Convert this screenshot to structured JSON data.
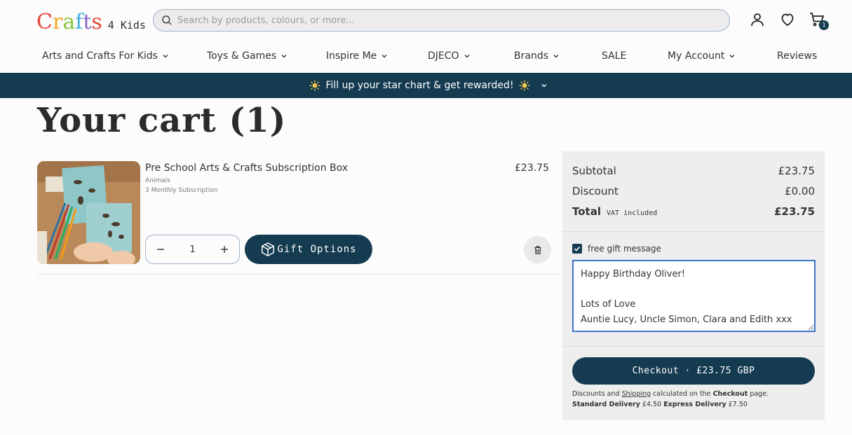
{
  "header": {
    "logo_word": "Crafts",
    "logo_letters": [
      "C",
      "r",
      "a",
      "f",
      "t",
      "s"
    ],
    "logo_colors": [
      "#e8473c",
      "#f4a51c",
      "#8cc63f",
      "#3fb1e0",
      "#8a63c9",
      "#e8473c"
    ],
    "logo_sub": "4 Kids",
    "search_placeholder": "Search by products, colours, or more...",
    "cart_count": "1"
  },
  "nav": {
    "items": [
      {
        "label": "Arts and Crafts For Kids",
        "dropdown": true
      },
      {
        "label": "Toys & Games",
        "dropdown": true
      },
      {
        "label": "Inspire Me",
        "dropdown": true
      },
      {
        "label": "DJECO",
        "dropdown": true
      },
      {
        "label": "Brands",
        "dropdown": true
      },
      {
        "label": "SALE",
        "dropdown": false
      },
      {
        "label": "My Account",
        "dropdown": true
      },
      {
        "label": "Reviews",
        "dropdown": false
      }
    ]
  },
  "banner": {
    "text": "Fill up your star chart & get rewarded!",
    "icon": "sun-icon"
  },
  "page": {
    "title": "Your cart (1)"
  },
  "cart": {
    "item": {
      "name": "Pre School Arts & Crafts Subscription Box",
      "variant": "Animals",
      "plan": "3 Monthly Subscription",
      "price": "£23.75",
      "quantity": "1"
    },
    "gift_button": "Gift Options"
  },
  "summary": {
    "subtotal_label": "Subtotal",
    "subtotal": "£23.75",
    "discount_label": "Discount",
    "discount": "£0.00",
    "total_label": "Total",
    "vat_label": "VAT included",
    "total": "£23.75",
    "gift_checkbox_label": "free gift message",
    "gift_checked": true,
    "gift_message": "Happy Birthday Oliver!\n\nLots of Love\nAuntie Lucy, Uncle Simon, Clara and Edith xxx",
    "checkout_label": "Checkout · £23.75 GBP",
    "note": {
      "discounts": "Discounts and",
      "shipping": "Shipping",
      "calculated": "calculated on the",
      "checkout": "Checkout",
      "page": "page.",
      "standard_label": "Standard Delivery",
      "standard_price": "£4.50",
      "express_label": "Express Delivery",
      "express_price": "£7.50"
    }
  },
  "colors": {
    "brand_dark": "#153b50",
    "focus_blue": "#3d74c9"
  }
}
